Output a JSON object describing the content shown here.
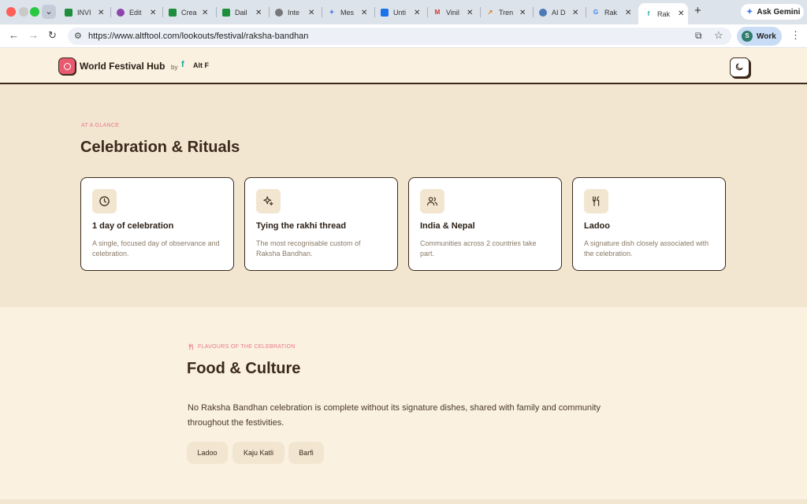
{
  "browser": {
    "tabs": [
      {
        "label": "INVI",
        "favicon": "sheets",
        "color": "#1e8e3e"
      },
      {
        "label": "Edit",
        "favicon": "purple-gem",
        "color": "#8e44ad"
      },
      {
        "label": "Crea",
        "favicon": "sheets",
        "color": "#1e8e3e"
      },
      {
        "label": "Dail",
        "favicon": "sheets",
        "color": "#1e8e3e"
      },
      {
        "label": "Inte",
        "favicon": "globe",
        "color": "#777777"
      },
      {
        "label": "Mes",
        "favicon": "gemini",
        "color": "#4b7bec"
      },
      {
        "label": "Unti",
        "favicon": "docs",
        "color": "#1a73e8"
      },
      {
        "label": "Vinil",
        "favicon": "gmail",
        "color": "#d93025"
      },
      {
        "label": "Tren",
        "favicon": "trends",
        "color": "#e37400"
      },
      {
        "label": "AI D",
        "favicon": "ai",
        "color": "#4a7ab5"
      },
      {
        "label": "Rak",
        "favicon": "google",
        "color": "#4285f4"
      },
      {
        "label": "Rak",
        "favicon": "altf",
        "color": "#1aa3a3",
        "active": true
      }
    ],
    "new_tab": "+",
    "ask_gemini": "Ask Gemini",
    "url": "https://www.altftool.com/lookouts/festival/raksha-bandhan",
    "profile_initial": "S",
    "profile_label": "Work"
  },
  "site": {
    "brand": "World Festival Hub",
    "by": "by",
    "partner": "Alt F"
  },
  "glance": {
    "eyebrow": "AT A GLANCE",
    "title": "Celebration & Rituals",
    "cards": [
      {
        "icon": "clock-icon",
        "title": "1 day of celebration",
        "desc": "A single, focused day of observance and celebration."
      },
      {
        "icon": "sparkles-icon",
        "title": "Tying the rakhi thread",
        "desc": "The most recognisable custom of Raksha Bandhan."
      },
      {
        "icon": "people-icon",
        "title": "India & Nepal",
        "desc": "Communities across 2 countries take part."
      },
      {
        "icon": "utensils-icon",
        "title": "Ladoo",
        "desc": "A signature dish closely associated with the celebration."
      }
    ]
  },
  "food": {
    "eyebrow": "FLAVOURS OF THE CELEBRATION",
    "title": "Food & Culture",
    "paragraph": "No Raksha Bandhan celebration is complete without its signature dishes, shared with family and community throughout the festivities.",
    "dishes": [
      "Ladoo",
      "Kaju Katli",
      "Barfi"
    ]
  },
  "colors": {
    "accent": "#e8788a",
    "ink": "#3b2a1c",
    "cream": "#fbf1e1",
    "sand": "#f2e6d0"
  }
}
